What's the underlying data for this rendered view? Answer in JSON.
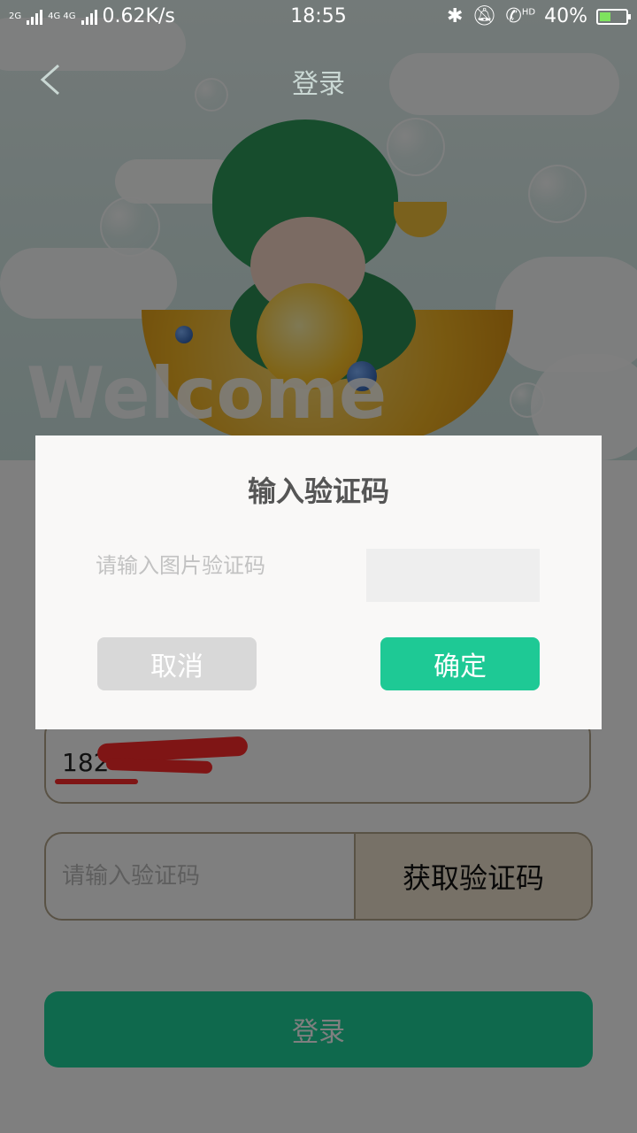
{
  "status_bar": {
    "net_type_1": "2G",
    "net_type_2": "4G 4G",
    "speed": "0.62K/s",
    "time": "18:55",
    "hd": "HD",
    "battery": "40%"
  },
  "header": {
    "title": "登录",
    "back_icon": "chevron-left-icon"
  },
  "hero": {
    "welcome_text": "Welcome"
  },
  "form": {
    "phone_value": "182",
    "code_placeholder": "请输入验证码",
    "get_code_label": "获取验证码",
    "login_label": "登录"
  },
  "dialog": {
    "title": "输入验证码",
    "image_code_placeholder": "请输入图片验证码",
    "cancel_label": "取消",
    "confirm_label": "确定"
  },
  "colors": {
    "accent_green": "#1ec995",
    "login_green": "#1fd39a",
    "cancel_gray": "#d8d8d8",
    "overlay": "rgba(0,0,0,0.5)"
  }
}
